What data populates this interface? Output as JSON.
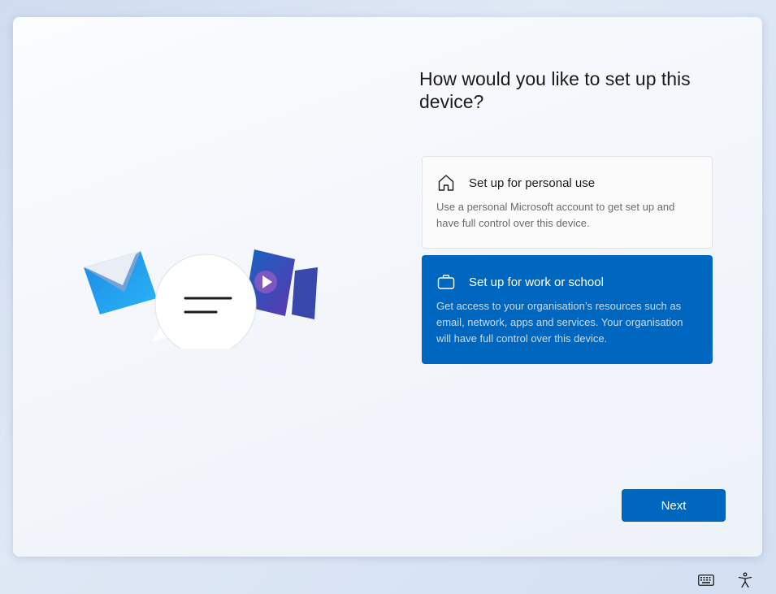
{
  "setup": {
    "title": "How would you like to set up this device?",
    "options": [
      {
        "icon": "home-icon",
        "title": "Set up for personal use",
        "description": "Use a personal Microsoft account to get set up and have full control over this device.",
        "selected": false
      },
      {
        "icon": "briefcase-icon",
        "title": "Set up for work or school",
        "description": "Get access to your organisation’s resources such as email, network, apps and services. Your organisation will have full control over this device.",
        "selected": true
      }
    ],
    "next_label": "Next"
  },
  "taskbar": {
    "icons": [
      "keyboard-icon",
      "accessibility-icon"
    ]
  },
  "colors": {
    "accent": "#0067c0",
    "selected_desc": "#c6dcf3",
    "card_bg": "#fbfbfb"
  }
}
